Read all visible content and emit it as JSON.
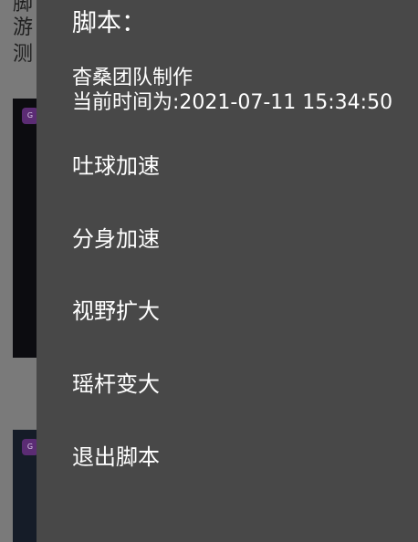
{
  "background": {
    "lines": [
      "脚",
      "游",
      "测"
    ]
  },
  "dialog": {
    "title": "脚本：",
    "author": "杳桑团队制作",
    "time_line": "当前时间为:2021-07-11 15:34:50",
    "items": [
      {
        "label": "吐球加速"
      },
      {
        "label": "分身加速"
      },
      {
        "label": "视野扩大"
      },
      {
        "label": "瑶杆变大"
      },
      {
        "label": "退出脚本"
      }
    ]
  },
  "colors": {
    "dialog_bg": "#484848",
    "overlay": "#7a7a7a",
    "text": "#ffffff"
  }
}
